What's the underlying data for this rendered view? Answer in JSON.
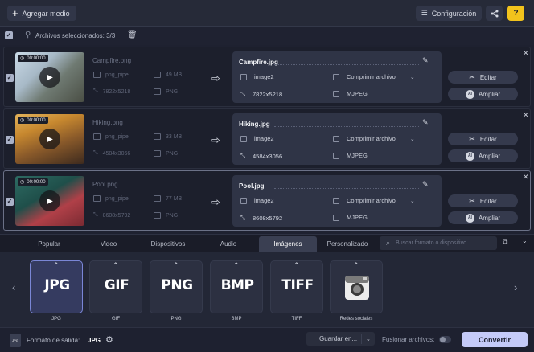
{
  "toolbar": {
    "add_media": "Agregar medio",
    "settings": "Configuración",
    "help": "?"
  },
  "selection": {
    "label": "Archivos seleccionados:",
    "count": "3/3"
  },
  "files": [
    {
      "duration": "00:00:00",
      "source_name": "Campfire.png",
      "source_codec": "png_pipe",
      "source_size": "49 MB",
      "source_dims": "7822x5218",
      "source_format": "PNG",
      "output_name": "Campfire.jpg",
      "out_codec": "image2",
      "out_compress": "Comprimir archivo",
      "out_dims": "7822x5218",
      "out_format": "MJPEG",
      "edit": "Editar",
      "enlarge": "Ampliar",
      "ai": "AI"
    },
    {
      "duration": "00:00:00",
      "source_name": "Hiking.png",
      "source_codec": "png_pipe",
      "source_size": "33 MB",
      "source_dims": "4584x3056",
      "source_format": "PNG",
      "output_name": "Hiking.jpg",
      "out_codec": "image2",
      "out_compress": "Comprimir archivo",
      "out_dims": "4584x3056",
      "out_format": "MJPEG",
      "edit": "Editar",
      "enlarge": "Ampliar",
      "ai": "AI"
    },
    {
      "duration": "00:00:00",
      "source_name": "Pool.png",
      "source_codec": "png_pipe",
      "source_size": "77 MB",
      "source_dims": "8608x5792",
      "source_format": "PNG",
      "output_name": "Pool.jpg",
      "out_codec": "image2",
      "out_compress": "Comprimir archivo",
      "out_dims": "8608x5792",
      "out_format": "MJPEG",
      "edit": "Editar",
      "enlarge": "Ampliar",
      "ai": "AI"
    }
  ],
  "tabs": [
    "Popular",
    "Video",
    "Dispositivos",
    "Audio",
    "Imágenes",
    "Personalizado"
  ],
  "active_tab": "Imágenes",
  "search": {
    "placeholder": "Buscar formato o dispositivo..."
  },
  "formats": [
    {
      "glyph": "JPG",
      "label": "JPG"
    },
    {
      "glyph": "GIF",
      "label": "GIF"
    },
    {
      "glyph": "PNG",
      "label": "PNG"
    },
    {
      "glyph": "BMP",
      "label": "BMP"
    },
    {
      "glyph": "TIFF",
      "label": "TIFF"
    },
    {
      "glyph": "",
      "label": "Redes sociales"
    }
  ],
  "bottom": {
    "output_label": "Formato de salida:",
    "output_value": "JPG",
    "output_icon": "JPG",
    "save_to": "Guardar en...",
    "merge_label": "Fusionar archivos:",
    "convert": "Convertir"
  },
  "colors": {
    "accent": "#c4caf8",
    "help": "#f2c31c",
    "active_format": "#353b60"
  }
}
